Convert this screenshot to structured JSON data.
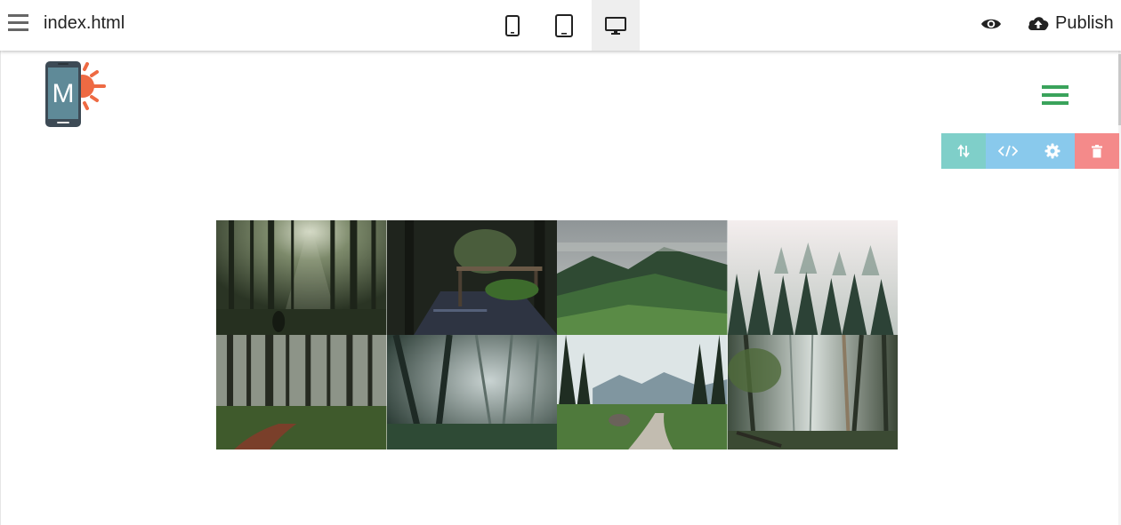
{
  "topbar": {
    "filename": "index.html",
    "menu_icon": "hamburger-menu-icon",
    "devices": [
      {
        "name": "mobile",
        "icon": "smartphone-icon",
        "active": false
      },
      {
        "name": "tablet",
        "icon": "tablet-icon",
        "active": false
      },
      {
        "name": "desktop",
        "icon": "desktop-monitor-icon",
        "active": true
      }
    ],
    "preview_icon": "eye-icon",
    "publish_label": "Publish",
    "publish_icon": "cloud-upload-icon"
  },
  "site": {
    "logo_letter": "M",
    "logo_icon": "phone-sun-logo",
    "menu_icon": "hamburger-menu-icon"
  },
  "block_toolbar": {
    "tools": [
      {
        "name": "move",
        "icon": "swap-vertical-icon",
        "color": "#7fcfc9"
      },
      {
        "name": "code",
        "icon": "code-icon",
        "color": "#89c9ec"
      },
      {
        "name": "settings",
        "icon": "gear-icon",
        "color": "#89c9ec"
      },
      {
        "name": "delete",
        "icon": "trash-icon",
        "color": "#f48a8a"
      }
    ]
  },
  "gallery": {
    "images": [
      {
        "subject": "sunlit pine forest with hiker"
      },
      {
        "subject": "forest path with wooden bench"
      },
      {
        "subject": "misty green mountain slope"
      },
      {
        "subject": "foggy pine tree tops"
      },
      {
        "subject": "dirt trail through tall pines"
      },
      {
        "subject": "misty leaning trees"
      },
      {
        "subject": "mountain road through valley"
      },
      {
        "subject": "misty birch forest"
      }
    ]
  },
  "colors": {
    "accent_green": "#3aa35b",
    "logo_orange": "#ee6a43",
    "logo_phone": "#3d4a55"
  }
}
